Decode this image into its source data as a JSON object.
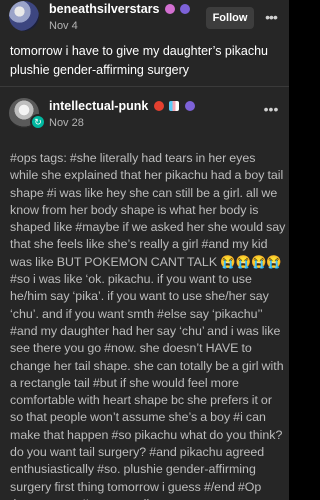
{
  "post1": {
    "username": "beneathsilverstars",
    "date": "Nov 4",
    "follow_label": "Follow",
    "more_glyph": "•••",
    "text": "tomorrow i have to give my daughter’s pikachu plushie gender-affirming surgery"
  },
  "post2": {
    "username": "intellectual-punk",
    "date": "Nov 28",
    "more_glyph": "•••",
    "reblog_icon": "reblog-icon",
    "tags": "#ops tags:  #she literally had tears in her eyes while she explained that her pikachu had a boy tail shape  #i was like hey she can still be a girl. all we know from her body shape is what her body is shaped like  #maybe if we asked her she would say that she feels like she’s really a girl  #and my kid was like BUT POKEMON CANT TALK 😭😭😭😭  #so i was like ‘ok. pikachu. if you want to use he/him say ‘pika’. if you want to use she/her say ‘chu’. and if you want smth  #else say ‘pikachu’’  #and my daughter had her say ‘chu’ and i was like see there you go  #now. she doesn’t HAVE to change her tail shape. she can totally be a girl with a rectangle tail  #but if she would feel more comfortable with heart shape bc she prefers it or so that people won’t assume she’s a boy  #i can make that happen  #so pikachu what do you think? do you want tail surgery?  #and pikachu agreed enthusiastically  #so. plushie gender-affirming surgery first thing tomorrow i guess  #/end  #Op thats so cute I’m gonna die"
  },
  "colors": {
    "background": "#262626",
    "follow_button": "#3d3d3d",
    "tag_text": "#bcbcbc"
  }
}
